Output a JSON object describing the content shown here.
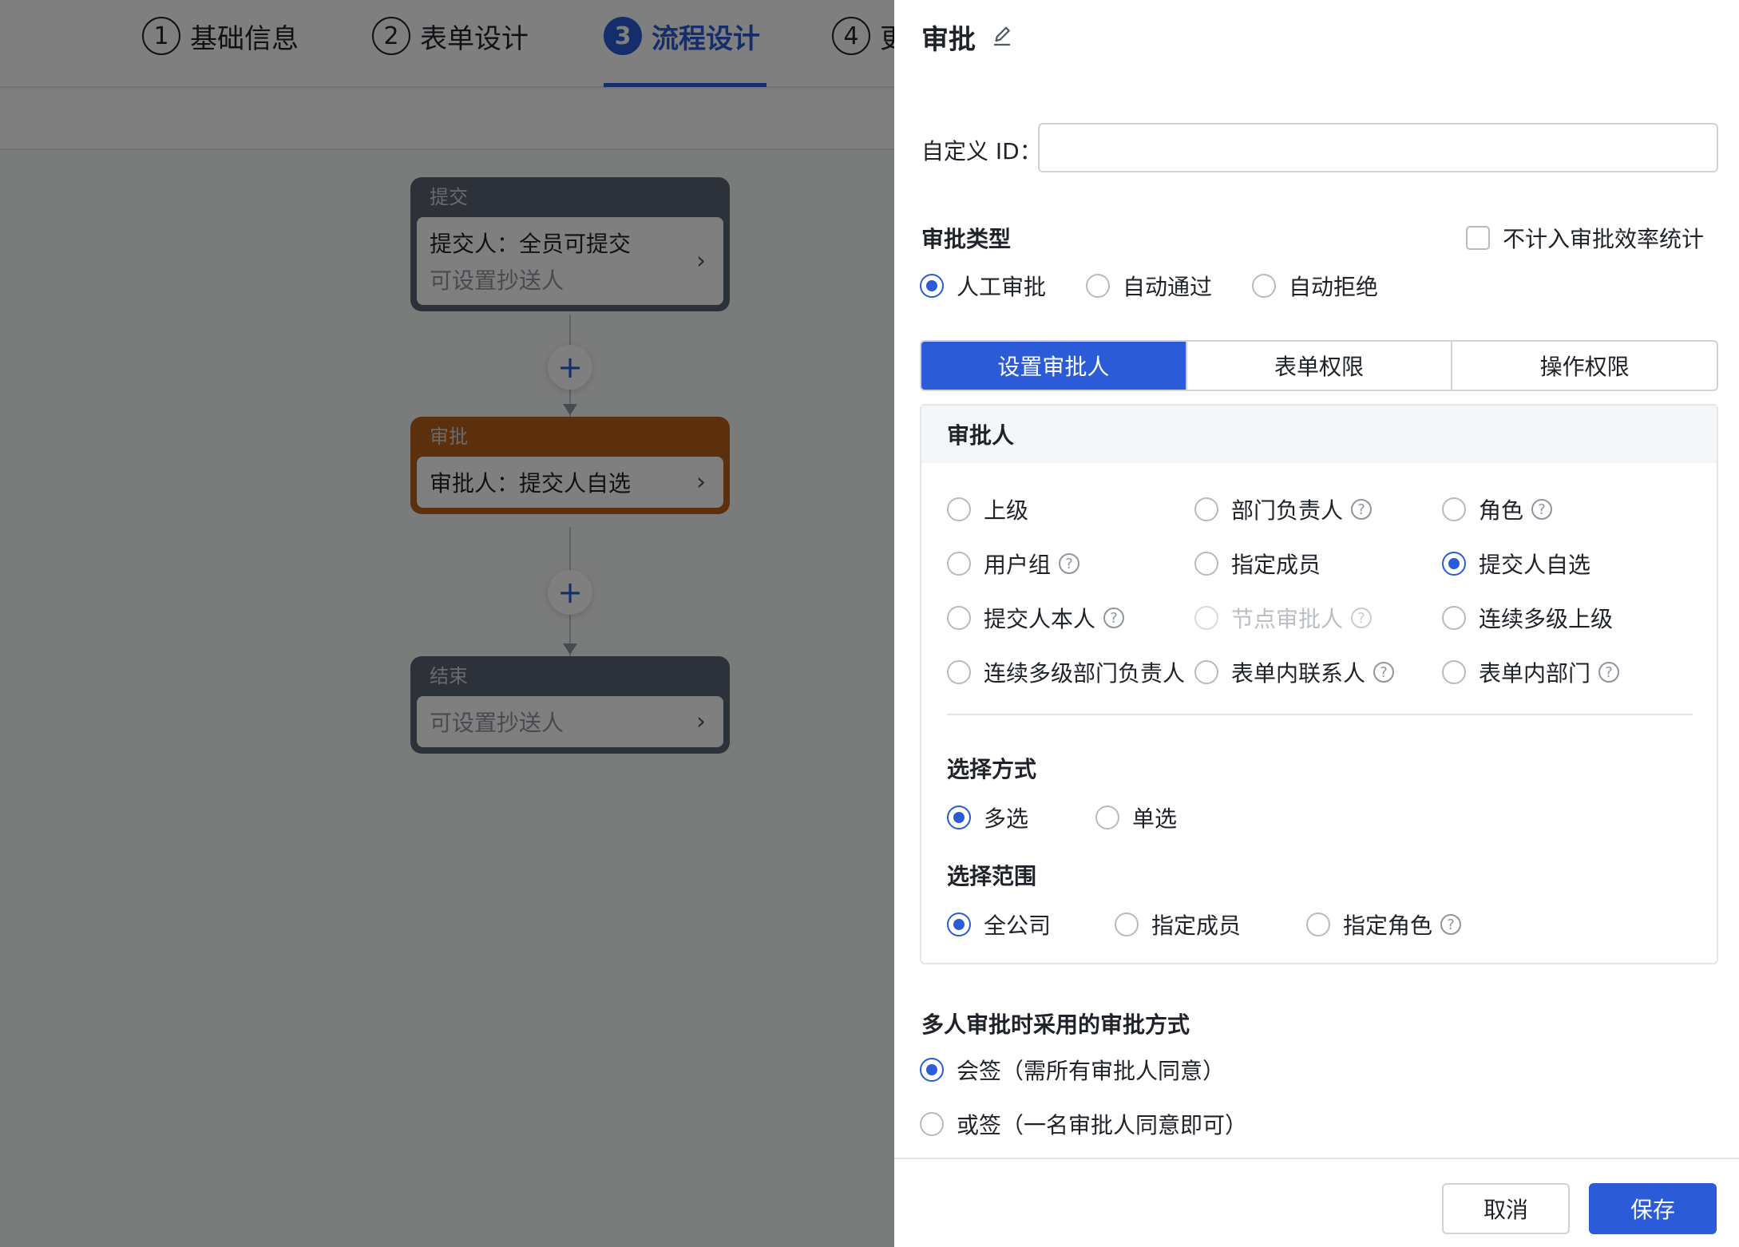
{
  "steps": [
    {
      "num": "1",
      "label": "基础信息"
    },
    {
      "num": "2",
      "label": "表单设计"
    },
    {
      "num": "3",
      "label": "流程设计"
    },
    {
      "num": "4",
      "label": "更"
    }
  ],
  "flow": {
    "submit": {
      "title": "提交",
      "line1": "提交人：全员可提交",
      "line2": "可设置抄送人"
    },
    "add_symbol": "+",
    "approve": {
      "title": "审批",
      "line1": "审批人：提交人自选"
    },
    "end": {
      "title": "结束",
      "line1": "可设置抄送人"
    }
  },
  "drawer": {
    "title": "审批",
    "custom_id_label": "自定义 ID：",
    "custom_id_value": "",
    "approval_type_label": "审批类型",
    "exclude_stats_label": "不计入审批效率统计",
    "approval_types": [
      "人工审批",
      "自动通过",
      "自动拒绝"
    ],
    "tabs": [
      "设置审批人",
      "表单权限",
      "操作权限"
    ],
    "approver_section_title": "审批人",
    "approver_options": [
      "上级",
      "部门负责人",
      "角色",
      "用户组",
      "指定成员",
      "提交人自选",
      "提交人本人",
      "节点审批人",
      "连续多级上级",
      "连续多级部门负责人",
      "表单内联系人",
      "表单内部门"
    ],
    "select_mode_label": "选择方式",
    "select_modes": [
      "多选",
      "单选"
    ],
    "select_range_label": "选择范围",
    "select_ranges": [
      "全公司",
      "指定成员",
      "指定角色"
    ],
    "multi_label": "多人审批时采用的审批方式",
    "multi_modes": [
      "会签（需所有审批人同意）",
      "或签（一名审批人同意即可）"
    ],
    "help_glyph": "?",
    "cancel": "取消",
    "save": "保存"
  },
  "colors": {
    "primary": "#2b5bd7",
    "approve_node": "#b9601a",
    "node_gray": "#5b6475"
  }
}
